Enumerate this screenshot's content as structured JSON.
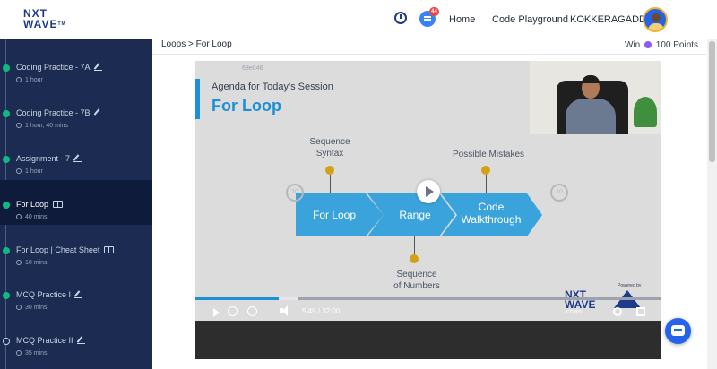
{
  "header": {
    "logo_line1": "NXT",
    "logo_line2": "WAVE",
    "logo_tm": "TM",
    "chat_badge": "44",
    "nav_home": "Home",
    "nav_code_playground": "Code Playground",
    "user_name": "KOKKERAGADDA"
  },
  "breadcrumb": "Loops > For Loop",
  "points": {
    "label": "Win",
    "value": "100 Points"
  },
  "sidebar": {
    "items": [
      {
        "title": "Coding Practice - 7A",
        "meta": "1 hour",
        "status": "completed"
      },
      {
        "title": "Coding Practice - 7B",
        "meta": "1 hour, 40 mins",
        "status": "completed"
      },
      {
        "title": "Assignment - 7",
        "meta": "1 hour",
        "status": "completed"
      },
      {
        "title": "For Loop",
        "meta": "40 mins",
        "status": "completed"
      },
      {
        "title": "For Loop | Cheat Sheet",
        "meta": "10 mins",
        "status": "completed"
      },
      {
        "title": "MCQ Practice I",
        "meta": "30 mins",
        "status": "completed"
      },
      {
        "title": "MCQ Practice II",
        "meta": "35 mins",
        "status": "open"
      }
    ]
  },
  "video": {
    "slide_id": "68e046",
    "slide_subtitle": "Agenda for Today's Session",
    "slide_title": "For Loop",
    "top_labels": [
      "Sequence\nSyntax",
      "Possible Mistakes"
    ],
    "arrow_labels": [
      "For Loop",
      "Range",
      "Code\nWalkthrough"
    ],
    "bottom_label": "Sequence\nof Numbers",
    "brand": "NXT\nWAVE",
    "powered_by": "Powered by",
    "current_time": "5:49",
    "separator": "/",
    "duration": "32:00",
    "progress_fraction": 0.18,
    "quality": "ccaro",
    "colors": {
      "accent": "#1d8fd6",
      "pin": "#d4a017",
      "arrow": "#3aa3dc"
    }
  },
  "colors": {
    "sidebar_bg": "#1b2b52",
    "complete_dot": "#10b981",
    "primary": "#2563eb"
  }
}
